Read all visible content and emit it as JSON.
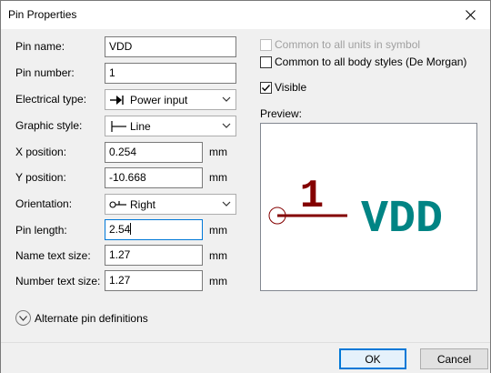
{
  "window": {
    "title": "Pin Properties"
  },
  "form": {
    "pin_name_label": "Pin name:",
    "pin_name_value": "VDD",
    "pin_number_label": "Pin number:",
    "pin_number_value": "1",
    "electrical_type_label": "Electrical type:",
    "electrical_type_value": "Power input",
    "electrical_type_icon": "power-input-icon",
    "graphic_style_label": "Graphic style:",
    "graphic_style_value": "Line",
    "graphic_style_icon": "line-style-icon",
    "x_position_label": "X position:",
    "x_position_value": "0.254",
    "x_position_unit": "mm",
    "y_position_label": "Y position:",
    "y_position_value": "-10.668",
    "y_position_unit": "mm",
    "orientation_label": "Orientation:",
    "orientation_value": "Right",
    "orientation_icon": "orientation-right-icon",
    "pin_length_label": "Pin length:",
    "pin_length_value": "2.54",
    "pin_length_unit": "mm",
    "name_text_size_label": "Name text size:",
    "name_text_size_value": "1.27",
    "name_text_size_unit": "mm",
    "number_text_size_label": "Number text size:",
    "number_text_size_value": "1.27",
    "number_text_size_unit": "mm"
  },
  "options": {
    "common_units_label": "Common to all units in symbol",
    "common_units_checked": false,
    "common_units_enabled": false,
    "common_body_label": "Common to all body styles (De Morgan)",
    "common_body_checked": false,
    "visible_label": "Visible",
    "visible_checked": true,
    "preview_label": "Preview:"
  },
  "preview": {
    "pin_number": "1",
    "pin_name": "VDD",
    "pin_color": "#840000",
    "name_color": "#008484"
  },
  "alternate": {
    "label": "Alternate pin definitions"
  },
  "buttons": {
    "ok": "OK",
    "cancel": "Cancel"
  }
}
